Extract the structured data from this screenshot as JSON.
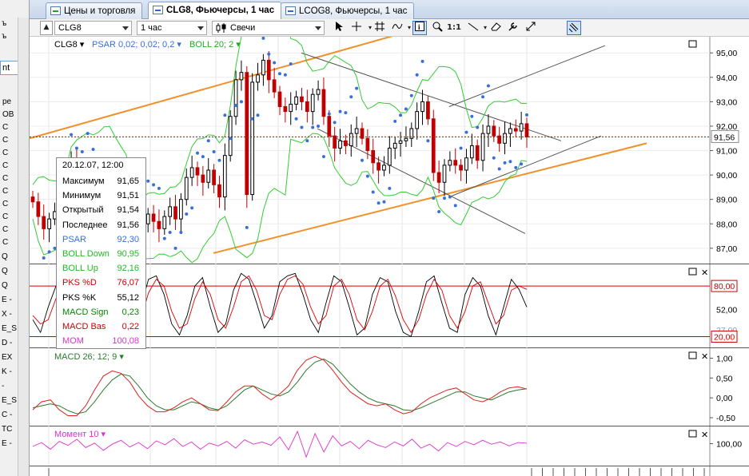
{
  "left_panel": {
    "input_value": "nt",
    "rows": [
      "Q",
      "Q",
      "Q",
      "E -",
      "X -",
      "E_S",
      "D -",
      "EX",
      "K -",
      "-",
      "E_S",
      "C -",
      "TC",
      "E -"
    ],
    "rows_top": [
      "ре",
      "OB",
      "C",
      "C",
      "C",
      "C",
      "C",
      "C",
      "C",
      "C",
      "C",
      "C"
    ],
    "bottom_label": "12"
  },
  "tabs": [
    {
      "label": "Цены и торговля",
      "active": false
    },
    {
      "label": "CLG8, Фьючерсы, 1 час",
      "active": true
    },
    {
      "label": "LCOG8, Фьючерсы, 1 час",
      "active": false
    }
  ],
  "toolbar": {
    "symbol": "CLG8",
    "interval": "1 час",
    "chart_type": "Свечи",
    "buttons": [
      "cursor",
      "crosshair",
      "grid",
      "indicators",
      "info",
      "zoom",
      "one-to-one",
      "trendline",
      "eraser",
      "settings",
      "expand",
      "magnet"
    ],
    "one_to_one_label": "1:1"
  },
  "main_panel": {
    "legend_symbol": "CLG8",
    "legend_psar": "PSAR 0,02; 0,02; 0,2",
    "legend_boll": "BOLL 20; 2",
    "price_label": "91,56",
    "colors": {
      "psar": "#3a6fd8",
      "boll": "#33cc33",
      "trend": "#f0902a",
      "bull": "#000000",
      "bear": "#c00000",
      "price_line": "#c00000"
    }
  },
  "tooltip": {
    "header": "20.12.07, 12:00",
    "rows": [
      {
        "key": "Максимум",
        "value": "91,65",
        "color": "#000000"
      },
      {
        "key": "Минимум",
        "value": "91,51",
        "color": "#000000"
      },
      {
        "key": "Открытый",
        "value": "91,54",
        "color": "#000000"
      },
      {
        "key": "Последнее",
        "value": "91,56",
        "color": "#000000"
      },
      {
        "key": "PSAR",
        "value": "92,30",
        "color": "#3a6fd8"
      },
      {
        "key": "BOLL Down",
        "value": "90,95",
        "color": "#22bb22"
      },
      {
        "key": "BOLL Up",
        "value": "92,16",
        "color": "#22bb22"
      },
      {
        "key": "PKS %D",
        "value": "76,07",
        "color": "#cc0000"
      },
      {
        "key": "PKS %K",
        "value": "55,12",
        "color": "#000000"
      },
      {
        "key": "MACD Sign",
        "value": "0,23",
        "color": "#008800"
      },
      {
        "key": "MACD Bas",
        "value": "0,22",
        "color": "#cc0000"
      },
      {
        "key": "MOM",
        "value": "100,08",
        "color": "#dd33cc"
      }
    ]
  },
  "stoch_panel": {
    "upper_label": "80,00",
    "lower_label": "20,00",
    "mid_label": "52,00",
    "clipped_label": "27,00"
  },
  "macd_panel": {
    "legend": "MACD 26; 12; 9"
  },
  "mom_panel": {
    "legend": "Момент 10",
    "axis_label": "100,00"
  },
  "chart_data": [
    {
      "type": "candlestick",
      "title": "CLG8",
      "yticks": [
        95,
        94,
        93,
        92,
        91,
        90,
        89,
        88,
        87
      ],
      "ytick_labels": [
        "95,00",
        "94,00",
        "93,00",
        "92,00",
        "91,00",
        "90,00",
        "89,00",
        "88,00",
        "87,00"
      ],
      "ylim": [
        86.7,
        95.4
      ],
      "series": [
        {
          "name": "CLG8",
          "close": [
            88.9,
            88.3,
            87.8,
            88.2,
            88.5,
            88.4,
            89.5,
            90.6,
            89.9,
            89.6,
            90.2,
            89.4,
            88.1,
            87.6,
            87.9,
            87.4,
            88.2,
            88.1,
            87.8,
            87.5,
            88.0,
            88.4,
            88.1,
            87.8,
            88.3,
            88.7,
            88.2,
            89.0,
            89.9,
            90.3,
            90.0,
            89.7,
            90.2,
            89.6,
            89.1,
            90.8,
            92.4,
            93.9,
            94.2,
            89.2,
            93.8,
            94.1,
            94.7,
            93.9,
            93.4,
            92.8,
            92.6,
            92.9,
            93.2,
            93.0,
            92.6,
            93.3,
            93.5,
            92.4,
            91.6,
            91.1,
            91.4,
            91.2,
            91.7,
            91.9,
            91.5,
            91.0,
            90.5,
            90.2,
            90.4,
            91.1,
            91.3,
            91.4,
            91.5,
            91.9,
            92.6,
            93.0,
            92.3,
            90.1,
            89.7,
            90.4,
            90.6,
            90.4,
            90.2,
            90.7,
            91.2,
            90.6,
            91.7,
            92.0,
            91.6,
            91.3,
            91.7,
            91.9,
            91.8,
            92.1,
            91.56
          ]
        }
      ]
    },
    {
      "type": "line",
      "title": "Stochastic",
      "ylim": [
        20,
        100
      ],
      "series": [
        {
          "name": "PKS %K",
          "values": [
            40,
            25,
            55,
            80,
            95,
            65,
            30,
            22,
            50,
            85,
            90,
            60,
            25,
            20,
            55,
            88,
            92,
            70,
            35,
            22,
            45,
            80,
            90,
            55,
            25,
            35,
            75,
            95,
            88,
            60,
            30,
            45,
            85,
            92,
            95,
            70,
            40,
            25,
            60,
            92,
            85,
            55,
            22,
            30,
            70,
            90,
            85,
            50,
            25,
            20,
            50,
            85,
            92,
            60,
            30,
            25,
            70,
            90,
            80,
            45,
            22,
            55,
            88,
            76,
            55
          ]
        },
        {
          "name": "PKS %D",
          "values": [
            45,
            35,
            40,
            65,
            85,
            80,
            50,
            30,
            35,
            70,
            85,
            75,
            40,
            25,
            40,
            72,
            88,
            80,
            50,
            30,
            35,
            65,
            85,
            70,
            40,
            30,
            55,
            85,
            92,
            75,
            45,
            40,
            70,
            88,
            92,
            82,
            55,
            35,
            45,
            80,
            88,
            70,
            40,
            28,
            50,
            80,
            88,
            68,
            40,
            25,
            40,
            70,
            88,
            75,
            45,
            30,
            50,
            80,
            85,
            60,
            35,
            45,
            75,
            80,
            76
          ]
        }
      ]
    },
    {
      "type": "line",
      "title": "MACD 26; 12; 9",
      "yticks": [
        1.0,
        0.5,
        0.0,
        -0.5
      ],
      "ytick_labels": [
        "1,00",
        "0,50",
        "0,00",
        "-0,50"
      ],
      "ylim": [
        -0.62,
        1.15
      ],
      "series": [
        {
          "name": "MACD Sign",
          "values": [
            -0.25,
            -0.2,
            -0.15,
            -0.2,
            -0.32,
            -0.4,
            -0.35,
            -0.1,
            0.2,
            0.45,
            0.6,
            0.55,
            0.3,
            0.0,
            -0.2,
            -0.3,
            -0.3,
            -0.2,
            -0.1,
            -0.15,
            -0.25,
            -0.3,
            -0.2,
            0.0,
            0.2,
            0.3,
            0.2,
            0.1,
            0.05,
            0.15,
            0.4,
            0.7,
            0.9,
            0.98,
            0.85,
            0.6,
            0.35,
            0.15,
            0.0,
            -0.1,
            -0.15,
            -0.2,
            -0.3,
            -0.32,
            -0.25,
            -0.15,
            -0.05,
            0.05,
            0.15,
            0.15,
            0.05,
            0.0,
            -0.05,
            0.05,
            0.15,
            0.2,
            0.23
          ]
        },
        {
          "name": "MACD Bas",
          "values": [
            -0.3,
            -0.1,
            -0.05,
            -0.3,
            -0.45,
            -0.45,
            -0.2,
            0.2,
            0.55,
            0.68,
            0.62,
            0.4,
            0.05,
            -0.2,
            -0.35,
            -0.35,
            -0.25,
            -0.1,
            0.0,
            -0.15,
            -0.3,
            -0.32,
            -0.1,
            0.15,
            0.3,
            0.3,
            0.1,
            -0.05,
            0.1,
            0.3,
            0.7,
            0.95,
            1.05,
            0.95,
            0.7,
            0.4,
            0.15,
            0.0,
            -0.15,
            -0.2,
            -0.15,
            -0.3,
            -0.4,
            -0.35,
            -0.15,
            0.0,
            0.1,
            0.2,
            0.25,
            0.1,
            -0.05,
            -0.1,
            0.0,
            0.15,
            0.25,
            0.28,
            0.22
          ]
        }
      ]
    },
    {
      "type": "line",
      "title": "Момент 10",
      "yticks": [
        100.0
      ],
      "ytick_labels": [
        "100,00"
      ],
      "ylim": [
        96.5,
        102.5
      ],
      "series": [
        {
          "name": "Момент 10",
          "values": [
            99.5,
            100.2,
            99.0,
            100.4,
            99.7,
            100.8,
            99.3,
            100.1,
            98.8,
            99.9,
            100.6,
            99.4,
            100.2,
            99.1,
            100.5,
            99.8,
            100.9,
            99.5,
            100.3,
            99.0,
            100.1,
            99.6,
            100.4,
            99.2,
            100.7,
            99.9,
            100.3,
            99.7,
            101.2,
            98.9,
            102.2,
            97.6,
            101.8,
            98.5,
            101.4,
            99.6,
            100.4,
            99.1,
            100.6,
            99.8,
            99.3,
            100.3,
            99.6,
            100.8,
            99.2,
            99.9,
            98.7,
            100.2,
            99.5,
            100.4,
            99.8,
            100.6,
            99.9,
            100.3,
            99.6,
            100.2,
            100.08
          ]
        }
      ]
    }
  ]
}
